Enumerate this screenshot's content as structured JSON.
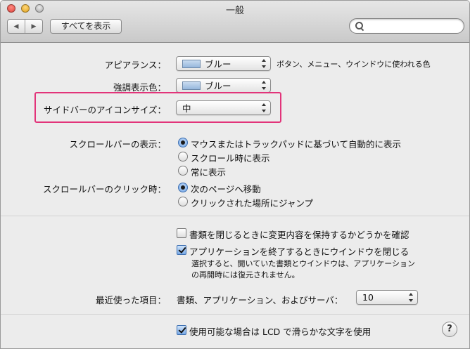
{
  "window": {
    "title": "一般"
  },
  "toolbar": {
    "back_icon": "◀",
    "forward_icon": "▶",
    "show_all_label": "すべてを表示",
    "search_value": "",
    "search_placeholder": ""
  },
  "appearance": {
    "label": "アピアランス：",
    "value": "ブルー",
    "description": "ボタン、メニュー、ウインドウに使われる色"
  },
  "highlight_color": {
    "label": "強調表示色：",
    "value": "ブルー"
  },
  "sidebar_icon_size": {
    "label": "サイドバーのアイコンサイズ：",
    "value": "中"
  },
  "show_scroll_bars": {
    "label": "スクロールバーの表示：",
    "options": [
      {
        "label": "マウスまたはトラックパッドに基づいて自動的に表示",
        "selected": true
      },
      {
        "label": "スクロール時に表示",
        "selected": false
      },
      {
        "label": "常に表示",
        "selected": false
      }
    ]
  },
  "scroll_click": {
    "label": "スクロールバーのクリック時：",
    "options": [
      {
        "label": "次のページへ移動",
        "selected": true
      },
      {
        "label": "クリックされた場所にジャンプ",
        "selected": false
      }
    ]
  },
  "ask_keep_changes": {
    "label": "書類を閉じるときに変更内容を保持するかどうかを確認",
    "checked": false
  },
  "close_windows": {
    "label": "アプリケーションを終了するときにウインドウを閉じる",
    "checked": true,
    "note_line1": "選択すると、開いていた書類とウインドウは、アプリケーション",
    "note_line2": "の再開時には復元されません。"
  },
  "recent_items": {
    "label": "最近使った項目：",
    "description": "書類、アプリケーション、およびサーバ：",
    "value": "10"
  },
  "lcd_smoothing": {
    "label": "使用可能な場合は LCD で滑らかな文字を使用",
    "checked": true
  },
  "help": {
    "label": "?"
  },
  "colors": {
    "highlight_box": "#e2347a",
    "selected_control": "#6ea3e5"
  }
}
